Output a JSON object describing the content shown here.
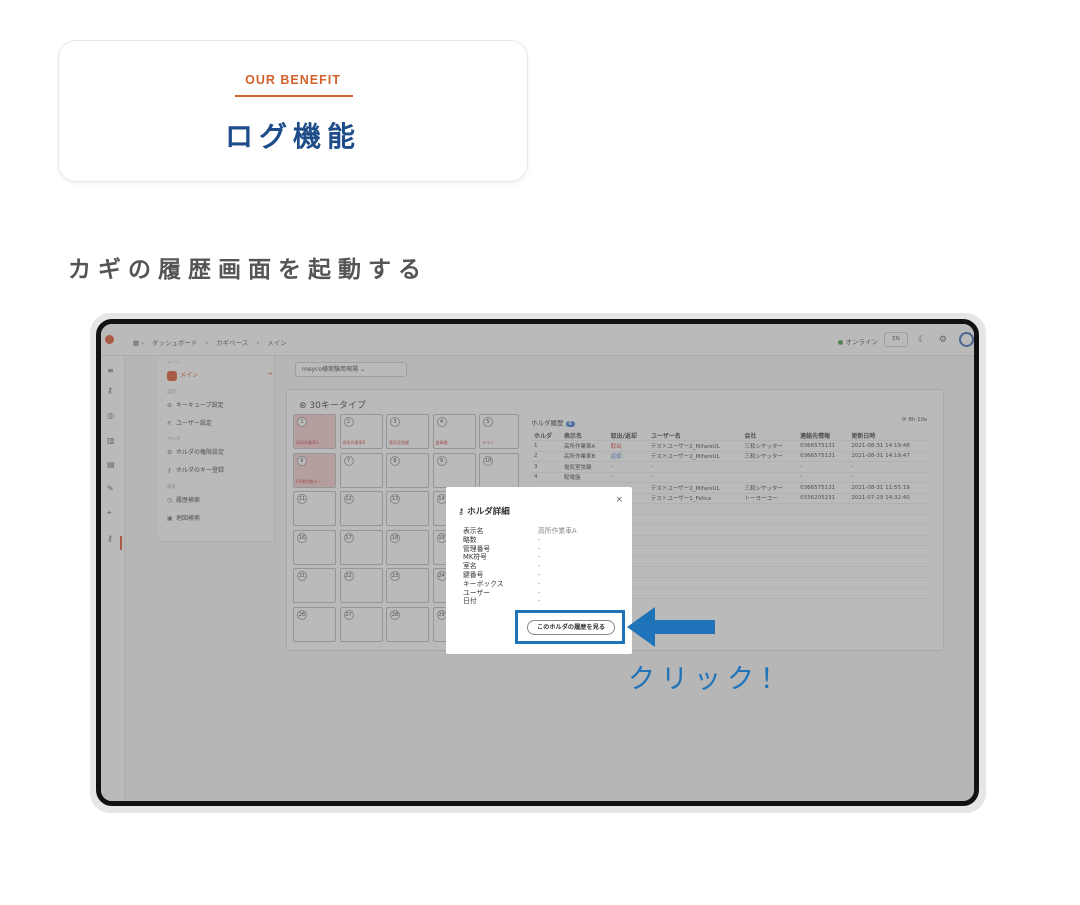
{
  "header": {
    "eyebrow": "OUR BENEFIT",
    "title": "ログ機能"
  },
  "section_title": "カギの履歴画面を起動する",
  "app": {
    "breadcrumbs": [
      "ダッシュボード",
      "カギベース",
      "メイン"
    ],
    "status": "オンライン",
    "lang_button": "EN",
    "nav": {
      "main_section": "メイン",
      "main_item": "メイン",
      "settings_section": "設定",
      "items_settings": [
        "キーキューブ設定",
        "ユーザー設定"
      ],
      "holder_section": "ホルダ",
      "items_holder": [
        "ホルダの権限設定",
        "ホルダのキー登録"
      ],
      "search_section": "検索",
      "items_search": [
        "履歴検索",
        "地図検索"
      ]
    },
    "site_select": "meyco様実験用現場",
    "panel_title": "30キータイプ",
    "slots": [
      {
        "num": "1",
        "label": "高所作業車A"
      },
      {
        "num": "2",
        "label": "高所作業車B"
      },
      {
        "num": "3",
        "label": "電気室弦鍵"
      },
      {
        "num": "4",
        "label": "倉庫鍵"
      },
      {
        "num": "5",
        "label": "テイン"
      },
      {
        "num": "6",
        "label": "EV操作盤キー"
      },
      {
        "num": "7",
        "label": ""
      },
      {
        "num": "8",
        "label": ""
      },
      {
        "num": "9",
        "label": ""
      },
      {
        "num": "10",
        "label": ""
      },
      {
        "num": "11",
        "label": ""
      },
      {
        "num": "12",
        "label": ""
      },
      {
        "num": "13",
        "label": ""
      },
      {
        "num": "14",
        "label": ""
      },
      {
        "num": "16",
        "label": ""
      },
      {
        "num": "17",
        "label": ""
      },
      {
        "num": "18",
        "label": ""
      },
      {
        "num": "19",
        "label": ""
      },
      {
        "num": "21",
        "label": ""
      },
      {
        "num": "22",
        "label": ""
      },
      {
        "num": "23",
        "label": ""
      },
      {
        "num": "24",
        "label": ""
      },
      {
        "num": "26",
        "label": ""
      },
      {
        "num": "27",
        "label": ""
      },
      {
        "num": "28",
        "label": ""
      },
      {
        "num": "29",
        "label": ""
      }
    ],
    "history": {
      "title": "ホルダ履歴",
      "count": "6",
      "refresh": "8h 10s",
      "columns": [
        "ホルダ",
        "表示名",
        "取出/返却",
        "ユーザー名",
        "会社",
        "連絡先情報",
        "更新日時"
      ],
      "rows": [
        [
          "1",
          "高所作業車A",
          "取出",
          "テストユーザー2_MifareUL",
          "三和シヤッター",
          "0366575131",
          "2021-08-31 14:19:48"
        ],
        [
          "2",
          "高所作業車B",
          "返却",
          "テストユーザー2_MifareUL",
          "三和シヤッター",
          "0366575131",
          "2021-08-31 14:19:47"
        ],
        [
          "3",
          "電気室弦鍵",
          "-",
          "-",
          "",
          "-",
          "-"
        ],
        [
          "4",
          "配電盤",
          "-",
          "-",
          "",
          "-",
          "-"
        ],
        [
          "",
          "",
          "",
          "テストユーザー2_MifareUL",
          "三和シヤッター",
          "0366575131",
          "2021-08-31 11:55:19"
        ],
        [
          "",
          "",
          "",
          "テストユーザー1_Felica",
          "トーヨーコー",
          "0336205231",
          "2021-07-29 14:32:40"
        ]
      ]
    }
  },
  "modal": {
    "title": "ホルダ詳細",
    "fields": [
      {
        "label": "表示名",
        "value": "高所作業車A"
      },
      {
        "label": "略数",
        "value": "-"
      },
      {
        "label": "管理番号",
        "value": "-"
      },
      {
        "label": "MK符号",
        "value": "-"
      },
      {
        "label": "室名",
        "value": "-"
      },
      {
        "label": "鍵番号",
        "value": "-"
      },
      {
        "label": "キーボックス",
        "value": "-"
      },
      {
        "label": "ユーザー",
        "value": "-"
      },
      {
        "label": "日付",
        "value": "-"
      }
    ],
    "button_label": "このホルダの履歴を見る",
    "close_glyph": "×"
  },
  "callout": "クリック！",
  "colors": {
    "accent_orange": "#d2622b",
    "title_blue": "#1e4d8a",
    "callout_blue": "#1e73b9"
  }
}
